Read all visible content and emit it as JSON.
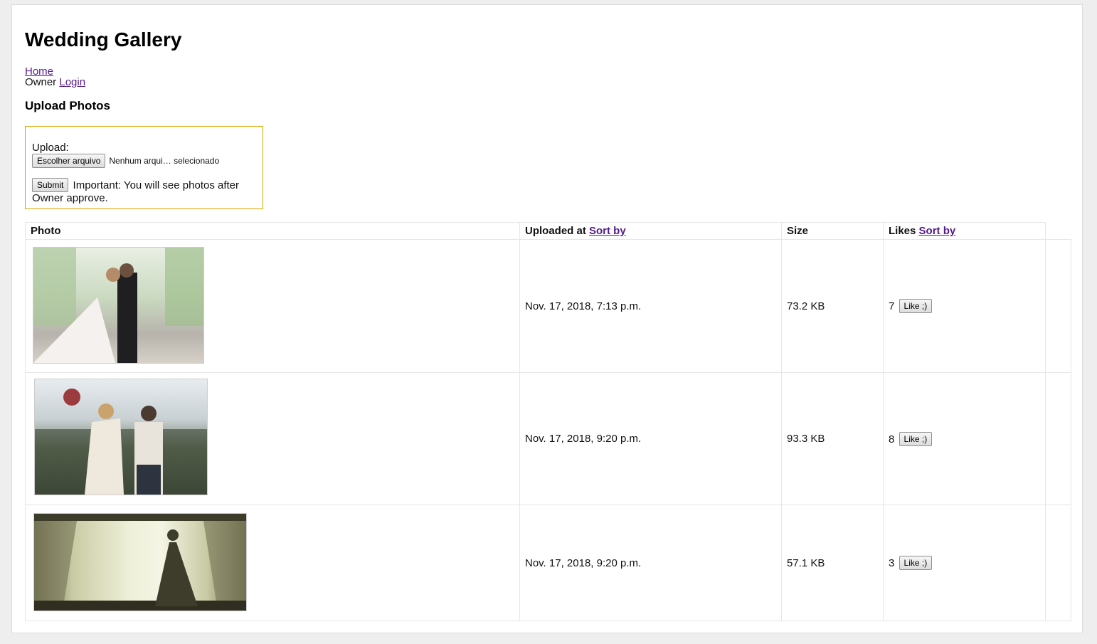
{
  "header": {
    "title": "Wedding Gallery"
  },
  "nav": {
    "home": "Home",
    "owner_prefix": "Owner",
    "login": "Login"
  },
  "upload": {
    "heading": "Upload Photos",
    "label": "Upload:",
    "choose_button": "Escolher arquivo",
    "file_status": "Nenhum arqui… selecionado",
    "submit_button": "Submit",
    "note": "Important: You will see photos after Owner approve."
  },
  "table": {
    "headers": {
      "photo": "Photo",
      "uploaded_at": "Uploaded at",
      "size": "Size",
      "likes": "Likes",
      "sort_by": "Sort by"
    },
    "rows": [
      {
        "uploaded_at": "Nov. 17, 2018, 7:13 p.m.",
        "size": "73.2 KB",
        "likes": "7",
        "like_button": "Like ;)"
      },
      {
        "uploaded_at": "Nov. 17, 2018, 9:20 p.m.",
        "size": "93.3 KB",
        "likes": "8",
        "like_button": "Like ;)"
      },
      {
        "uploaded_at": "Nov. 17, 2018, 9:20 p.m.",
        "size": "57.1 KB",
        "likes": "3",
        "like_button": "Like ;)"
      }
    ]
  },
  "colors": {
    "link": "#551a8b",
    "upload_border": "#d9a400",
    "page_bg": "#eeeeee"
  }
}
